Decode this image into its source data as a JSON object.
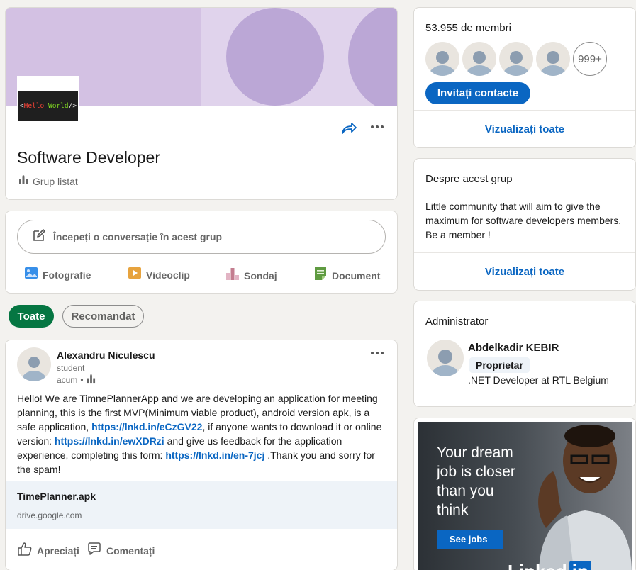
{
  "group": {
    "name": "Software Developer",
    "type": "Grup listat",
    "logo_text": {
      "open": "<",
      "hello": "Hello",
      "world": "World",
      "close": "/>"
    }
  },
  "composer": {
    "placeholder": "Începeți o conversație în acest grup",
    "actions": [
      {
        "label": "Fotografie",
        "icon": "photo-icon",
        "color": "#378fe9"
      },
      {
        "label": "Videoclip",
        "icon": "video-icon",
        "color": "#e7a33e"
      },
      {
        "label": "Sondaj",
        "icon": "poll-icon",
        "color": "#c37d8f"
      },
      {
        "label": "Document",
        "icon": "document-icon",
        "color": "#5f9b41"
      }
    ]
  },
  "filters": {
    "all": "Toate",
    "recommended": "Recomandat"
  },
  "post": {
    "author": "Alexandru Niculescu",
    "headline": "student",
    "time": "acum",
    "time_sep": "•",
    "text": {
      "p1": "Hello! We are TimnePlannerApp and we are developing an application for meeting planning, this is the first MVP(Minimum viable product), android version apk, is a safe application, ",
      "link1": "https://lnkd.in/eCzGV22",
      "p2": ", if anyone wants to download it or online version: ",
      "link2": "https://lnkd.in/ewXDRzi",
      "p3": " and give us feedback for the application experience, completing this form: ",
      "link3": "https://lnkd.in/en-7jcj",
      "p4": " .Thank you and sorry for the spam!"
    },
    "attachment": {
      "title": "TimePlanner.apk",
      "domain": "drive.google.com"
    },
    "like_label": "Apreciați",
    "comment_label": "Comentați"
  },
  "members": {
    "count": "53.955 de membri",
    "more": "999+",
    "invite": "Invitați contacte",
    "view_all": "Vizualizați toate"
  },
  "about": {
    "heading": "Despre acest grup",
    "description": "Little community that will aim to give the maximum for software developers members. Be a member !",
    "view_all": "Vizualizați toate"
  },
  "admin": {
    "heading": "Administrator",
    "name": "Abdelkadir KEBIR",
    "badge": "Proprietar",
    "headline": ".NET Developer at RTL Belgium"
  },
  "ad": {
    "headline": "Your dream job is closer than you think",
    "cta": "See jobs",
    "brand": "Linked",
    "brand_in": "in"
  },
  "colors": {
    "accent": "#0a66c2",
    "green": "#057642"
  }
}
